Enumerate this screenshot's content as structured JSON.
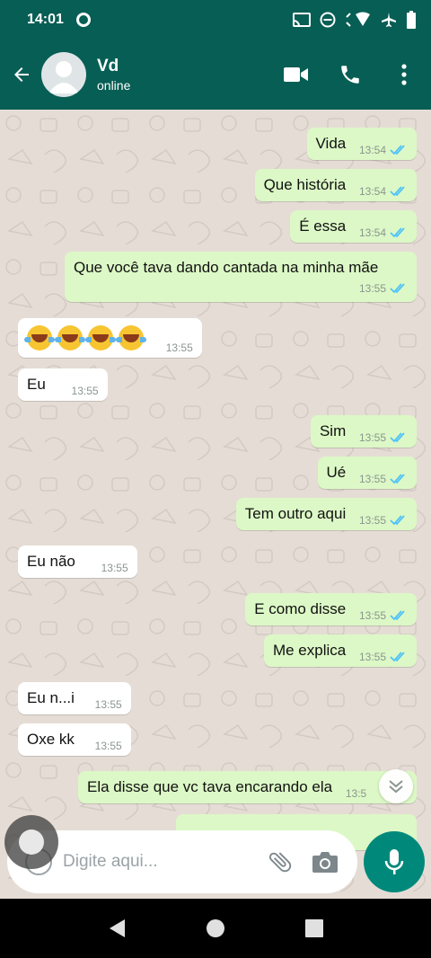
{
  "status_bar": {
    "time": "14:01"
  },
  "header": {
    "contact_name": "Vd",
    "contact_status": "online"
  },
  "messages": [
    {
      "dir": "out",
      "text": "Vida",
      "time": "13:54",
      "read": true
    },
    {
      "dir": "out",
      "text": "Que história",
      "time": "13:54",
      "read": true
    },
    {
      "dir": "out",
      "text": "É essa",
      "time": "13:54",
      "read": true
    },
    {
      "dir": "out",
      "text": "Que você tava dando cantada na minha mãe",
      "time": "13:55",
      "read": true
    },
    {
      "dir": "in",
      "emoji": "😂😂😂😂",
      "time": "13:55"
    },
    {
      "dir": "in",
      "text": "Eu",
      "time": "13:55"
    },
    {
      "dir": "out",
      "text": "Sim",
      "time": "13:55",
      "read": true
    },
    {
      "dir": "out",
      "text": "Ué",
      "time": "13:55",
      "read": true
    },
    {
      "dir": "out",
      "text": "Tem outro aqui",
      "time": "13:55",
      "read": true
    },
    {
      "dir": "in",
      "text": "Eu não",
      "time": "13:55"
    },
    {
      "dir": "out",
      "text": "E como disse",
      "time": "13:55",
      "read": true
    },
    {
      "dir": "out",
      "text": "Me explica",
      "time": "13:55",
      "read": true
    },
    {
      "dir": "in",
      "text": "Eu n...i",
      "time": "13:55"
    },
    {
      "dir": "in",
      "text": "Oxe kk",
      "time": "13:55"
    },
    {
      "dir": "out",
      "text": "Ela disse que vc tava encarando ela",
      "time": "13:5"
    }
  ],
  "composer": {
    "placeholder": "Digite aqui..."
  },
  "colors": {
    "header": "#075e54",
    "outgoing": "#dcf8c6",
    "incoming": "#ffffff",
    "chat_bg": "#e5ddd5",
    "tick_read": "#4fc3f7",
    "mic": "#00897b"
  }
}
